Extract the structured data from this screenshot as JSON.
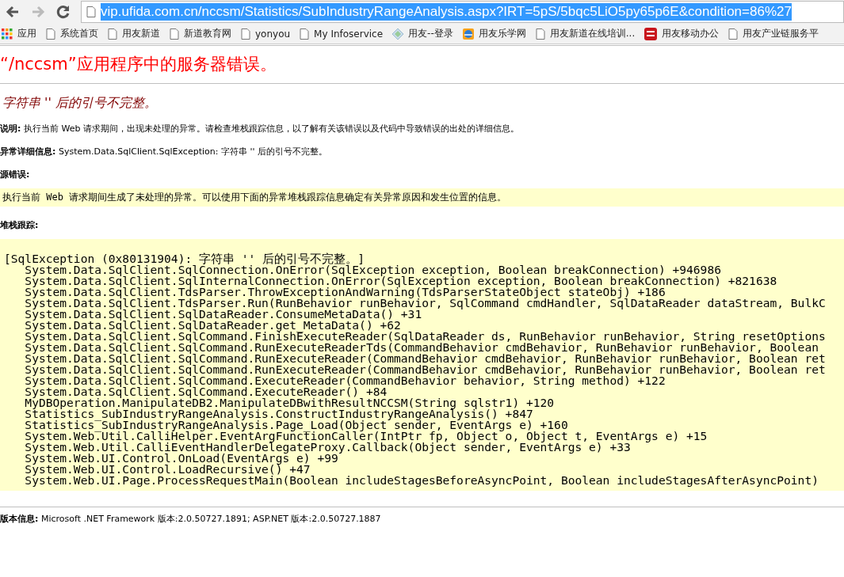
{
  "browser": {
    "url": {
      "value": "vip.ufida.com.cn/nccsm/Statistics/SubIndustryRangeAnalysis.aspx?IRT=5pS/5bqc5LiO5py65p6E&condition=86%27",
      "selected": true
    },
    "bookmarks": [
      {
        "label": "应用",
        "kind": "apps"
      },
      {
        "label": "系统首页",
        "kind": "page"
      },
      {
        "label": "用友新道",
        "kind": "page"
      },
      {
        "label": "新道教育网",
        "kind": "page"
      },
      {
        "label": "yonyou",
        "kind": "page"
      },
      {
        "label": "My Infoservice",
        "kind": "page"
      },
      {
        "label": "用友--登录",
        "kind": "diamond"
      },
      {
        "label": "用友乐学网",
        "kind": "globe"
      },
      {
        "label": "用友新道在线培训...",
        "kind": "page"
      },
      {
        "label": "用友移动办公",
        "kind": "badge"
      },
      {
        "label": "用友产业链服务平",
        "kind": "page"
      }
    ]
  },
  "page": {
    "title": "“/nccsm”应用程序中的服务器错误。",
    "subtitle": "字符串 '' 后的引号不完整。",
    "description": "**说明:** 执行当前 Web 请求期间，出现未处理的异常。请检查堆栈跟踪信息，以了解有关该错误以及代码中导致错误的出处的详细信息。",
    "exception_details": "**异常详细信息:** System.Data.SqlClient.SqlException: 字符串 '' 后的引号不完整。",
    "source_error_label": "源错误:",
    "source_error": "执行当前 Web 请求期间生成了未处理的异常。可以使用下面的异常堆栈跟踪信息确定有关异常原因和发生位置的信息。",
    "stack_trace_label": "堆栈跟踪:",
    "stack_trace": [
      "[SqlException (0x80131904): 字符串 '' 后的引号不完整。]",
      "   System.Data.SqlClient.SqlConnection.OnError(SqlException exception, Boolean breakConnection) +946986",
      "   System.Data.SqlClient.SqlInternalConnection.OnError(SqlException exception, Boolean breakConnection) +821638",
      "   System.Data.SqlClient.TdsParser.ThrowExceptionAndWarning(TdsParserStateObject stateObj) +186",
      "   System.Data.SqlClient.TdsParser.Run(RunBehavior runBehavior, SqlCommand cmdHandler, SqlDataReader dataStream, BulkC",
      "   System.Data.SqlClient.SqlDataReader.ConsumeMetaData() +31",
      "   System.Data.SqlClient.SqlDataReader.get_MetaData() +62",
      "   System.Data.SqlClient.SqlCommand.FinishExecuteReader(SqlDataReader ds, RunBehavior runBehavior, String resetOptions",
      "   System.Data.SqlClient.SqlCommand.RunExecuteReaderTds(CommandBehavior cmdBehavior, RunBehavior runBehavior, Boolean",
      "   System.Data.SqlClient.SqlCommand.RunExecuteReader(CommandBehavior cmdBehavior, RunBehavior runBehavior, Boolean ret",
      "   System.Data.SqlClient.SqlCommand.RunExecuteReader(CommandBehavior cmdBehavior, RunBehavior runBehavior, Boolean ret",
      "   System.Data.SqlClient.SqlCommand.ExecuteReader(CommandBehavior behavior, String method) +122",
      "   System.Data.SqlClient.SqlCommand.ExecuteReader() +84",
      "   MyDBOperation.ManipulateDB2.ManipulateDBwithResultNCCSM(String sqlstr1) +120",
      "   Statistics_SubIndustryRangeAnalysis.ConstructIndustryRangeAnalysis() +847",
      "   Statistics_SubIndustryRangeAnalysis.Page_Load(Object sender, EventArgs e) +160",
      "   System.Web.Util.CalliHelper.EventArgFunctionCaller(IntPtr fp, Object o, Object t, EventArgs e) +15",
      "   System.Web.Util.CalliEventHandlerDelegateProxy.Callback(Object sender, EventArgs e) +33",
      "   System.Web.UI.Control.OnLoad(EventArgs e) +99",
      "   System.Web.UI.Control.LoadRecursive() +47",
      "   System.Web.UI.Page.ProcessRequestMain(Boolean includeStagesBeforeAsyncPoint, Boolean includeStagesAfterAsyncPoint)"
    ],
    "version_info": "**版本信息:** Microsoft .NET Framework 版本:2.0.50727.1891; ASP.NET 版本:2.0.50727.1887"
  }
}
